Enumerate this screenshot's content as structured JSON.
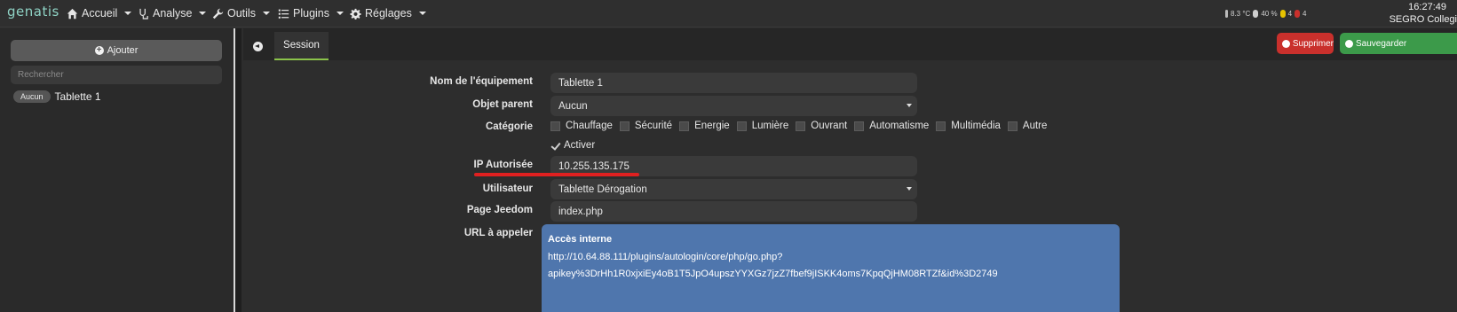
{
  "navbar": {
    "logo": "genatis",
    "menu": [
      {
        "label": "Accueil",
        "icon": "home-icon"
      },
      {
        "label": "Analyse",
        "icon": "stethoscope-icon"
      },
      {
        "label": "Outils",
        "icon": "wrench-icon"
      },
      {
        "label": "Plugins",
        "icon": "list-icon"
      },
      {
        "label": "Réglages",
        "icon": "gear-icon"
      }
    ],
    "weather": {
      "temperature": "8.3 °C",
      "humidity": "40 %",
      "lights": "4",
      "alerts": "4"
    },
    "clock": "16:27:49",
    "site": "SEGRO Collegi"
  },
  "sidebar": {
    "add_label": "Ajouter",
    "search_placeholder": "Rechercher",
    "items": [
      {
        "badge": "Aucun",
        "name": "Tablette 1"
      }
    ]
  },
  "tabs": {
    "session_label": "Session"
  },
  "actions": {
    "delete_label": "Supprimer",
    "save_label": "Sauvegarder"
  },
  "form": {
    "name_label": "Nom de l'équipement",
    "name_value": "Tablette 1",
    "parent_label": "Objet parent",
    "parent_value": "Aucun",
    "category_label": "Catégorie",
    "categories": [
      "Chauffage",
      "Sécurité",
      "Energie",
      "Lumière",
      "Ouvrant",
      "Automatisme",
      "Multimédia",
      "Autre"
    ],
    "activate_label": "Activer",
    "ip_label": "IP Autorisée",
    "ip_value": "10.255.135.175",
    "user_label": "Utilisateur",
    "user_value": "Tablette Dérogation",
    "page_label": "Page Jeedom",
    "page_value": "index.php",
    "url_label": "URL à appeler",
    "url_title": "Accès interne",
    "url_line1": "http://10.64.88.111/plugins/autologin/core/php/go.php?",
    "url_line2": "apikey%3DrHh1R0xjxiEy4oB1T5JpO4upszYYXGz7jzZ7fbef9jISKK4oms7KpqQjHM08RTZf&id%3D2749"
  },
  "colors": {
    "accent_green": "#8bc34a",
    "delete_red": "#c9302c",
    "save_green": "#3c9a4a",
    "url_blue": "#4f76ad",
    "annotation_red": "#e02020"
  }
}
